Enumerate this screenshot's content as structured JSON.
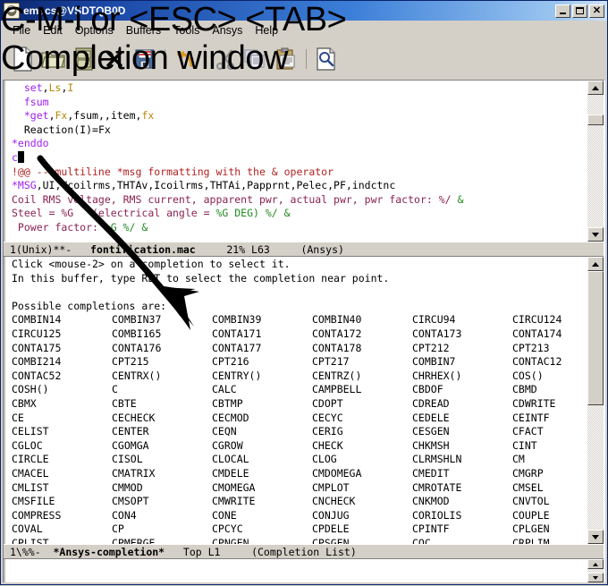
{
  "window": {
    "title": "emacs@VSDTQB0D",
    "icon": "emacs-icon",
    "controls": {
      "minimize": "_",
      "maximize": "□",
      "close": "✕"
    }
  },
  "menubar": {
    "items": [
      "File",
      "Edit",
      "Options",
      "Buffers",
      "Tools",
      "Ansys",
      "Help"
    ]
  },
  "toolbar": {
    "items": [
      {
        "name": "new-file-icon",
        "tooltip": "New File"
      },
      {
        "name": "open-folder-icon",
        "tooltip": "Open File"
      },
      {
        "name": "dired-cabinet-icon",
        "tooltip": "Open Directory"
      },
      {
        "name": "close-x-icon",
        "tooltip": "Kill Buffer"
      },
      {
        "name": "save-floppy-icon",
        "tooltip": "Save Buffer"
      },
      {
        "name": "undo-arrow-icon",
        "tooltip": "Undo"
      },
      {
        "name": "cut-scissors-icon",
        "tooltip": "Cut"
      },
      {
        "name": "copy-pages-icon",
        "tooltip": "Copy"
      },
      {
        "name": "paste-clipboard-icon",
        "tooltip": "Paste"
      },
      {
        "name": "search-magnifier-icon",
        "tooltip": "Search"
      }
    ]
  },
  "top_window": {
    "lines": [
      {
        "indent": "  ",
        "parts": [
          {
            "t": "set",
            "c": "kw"
          },
          {
            "t": ",",
            "c": "plain"
          },
          {
            "t": "Ls",
            "c": "var"
          },
          {
            "t": ",",
            "c": "plain"
          },
          {
            "t": "I",
            "c": "var"
          }
        ]
      },
      {
        "indent": "  ",
        "parts": [
          {
            "t": "fsum",
            "c": "kw"
          }
        ]
      },
      {
        "indent": "  ",
        "parts": [
          {
            "t": "*get",
            "c": "kw"
          },
          {
            "t": ",",
            "c": "plain"
          },
          {
            "t": "Fx",
            "c": "var"
          },
          {
            "t": ",fsum,,item,",
            "c": "plain"
          },
          {
            "t": "fx",
            "c": "var"
          }
        ]
      },
      {
        "indent": "  ",
        "parts": [
          {
            "t": "Reaction(I)=Fx",
            "c": "plain"
          }
        ]
      },
      {
        "indent": "",
        "parts": [
          {
            "t": "*enddo",
            "c": "kw"
          }
        ]
      },
      {
        "indent": "",
        "parts": [
          {
            "t": "c",
            "c": "kw"
          },
          {
            "t": "CURSOR",
            "c": "cursor"
          }
        ]
      },
      {
        "indent": "",
        "parts": [
          {
            "t": "!@@ -- multiline *msg formatting with the & operator",
            "c": "cmt"
          }
        ]
      },
      {
        "indent": "",
        "parts": [
          {
            "t": "*MSG",
            "c": "kw"
          },
          {
            "t": ",UI,Vcoilrms,THTAv,Icoilrms,THTAi,Papprnt,Pelec,PF,indctnc",
            "c": "plain"
          }
        ]
      },
      {
        "indent": "",
        "parts": [
          {
            "t": "Coil RMS voltage, RMS current, apparent pwr, actual pwr, pwr factor: %/ ",
            "c": "str"
          },
          {
            "t": "&",
            "c": "grn"
          }
        ]
      },
      {
        "indent": "",
        "parts": [
          {
            "t": "Steel = %G   (electrical angle = ",
            "c": "str"
          },
          {
            "t": "%G DEG) %/ ",
            "c": "grn"
          },
          {
            "t": "&",
            "c": "grn"
          }
        ]
      },
      {
        "indent": "",
        "parts": [
          {
            "t": " Power factor: ",
            "c": "str"
          },
          {
            "t": "%G %/ &",
            "c": "grn"
          }
        ]
      }
    ],
    "modeline": {
      "left": "1(Unix)**-",
      "buffer": "fontification.mac",
      "position": "21% L63",
      "mode": "(Ansys)"
    }
  },
  "completion_window": {
    "instructions": [
      "Click <mouse-2> on a completion to select it.",
      "In this buffer, type RET to select the completion near point.",
      "",
      "Possible completions are:"
    ],
    "columns": 6,
    "rows": [
      [
        "COMBIN14",
        "COMBIN37",
        "COMBIN39",
        "COMBIN40",
        "CIRCU94",
        "CIRCU124"
      ],
      [
        "CIRCU125",
        "COMBI165",
        "CONTA171",
        "CONTA172",
        "CONTA173",
        "CONTA174"
      ],
      [
        "CONTA175",
        "CONTA176",
        "CONTA177",
        "CONTA178",
        "CPT212",
        "CPT213"
      ],
      [
        "COMBI214",
        "CPT215",
        "CPT216",
        "CPT217",
        "COMBIN7",
        "CONTAC12"
      ],
      [
        "CONTAC52",
        "CENTRX()",
        "CENTRY()",
        "CENTRZ()",
        "CHRHEX()",
        "COS()"
      ],
      [
        "COSH()",
        "C",
        "CALC",
        "CAMPBELL",
        "CBDOF",
        "CBMD"
      ],
      [
        "CBMX",
        "CBTE",
        "CBTMP",
        "CDOPT",
        "CDREAD",
        "CDWRITE"
      ],
      [
        "CE",
        "CECHECK",
        "CECMOD",
        "CECYC",
        "CEDELE",
        "CEINTF"
      ],
      [
        "CELIST",
        "CENTER",
        "CEQN",
        "CERIG",
        "CESGEN",
        "CFACT"
      ],
      [
        "CGLOC",
        "CGOMGA",
        "CGROW",
        "CHECK",
        "CHKMSH",
        "CINT"
      ],
      [
        "CIRCLE",
        "CISOL",
        "CLOCAL",
        "CLOG",
        "CLRMSHLN",
        "CM"
      ],
      [
        "CMACEL",
        "CMATRIX",
        "CMDELE",
        "CMDOMEGA",
        "CMEDIT",
        "CMGRP"
      ],
      [
        "CMLIST",
        "CMMOD",
        "CMOMEGA",
        "CMPLOT",
        "CMROTATE",
        "CMSEL"
      ],
      [
        "CMSFILE",
        "CMSOPT",
        "CMWRITE",
        "CNCHECK",
        "CNKMOD",
        "CNVTOL"
      ],
      [
        "COMPRESS",
        "CON4",
        "CONE",
        "CONJUG",
        "CORIOLIS",
        "COUPLE"
      ],
      [
        "COVAL",
        "CP",
        "CPCYC",
        "CPDELE",
        "CPINTF",
        "CPLGEN"
      ],
      [
        "CPLIST",
        "CPMERGE",
        "CPNGEN",
        "CPSGEN",
        "CQC",
        "CRPLIM"
      ]
    ],
    "modeline": {
      "left": "1\\%%-",
      "buffer": "*Ansys-completion*",
      "position": "Top L1",
      "mode": "(Completion List)"
    }
  },
  "annotations": {
    "keybinding_label": "C-M-i or <ESC> <TAB>",
    "completion_label": "Completion window",
    "arrow": "curved-down-arrow"
  },
  "colors": {
    "keyword": "#a020f0",
    "variable": "#b8860b",
    "comment": "#b22222",
    "string": "#8b2252",
    "green": "#228b22",
    "titlebar_start": "#0a246a",
    "titlebar_end": "#cfe3f8",
    "chrome": "#d4d0c8"
  }
}
